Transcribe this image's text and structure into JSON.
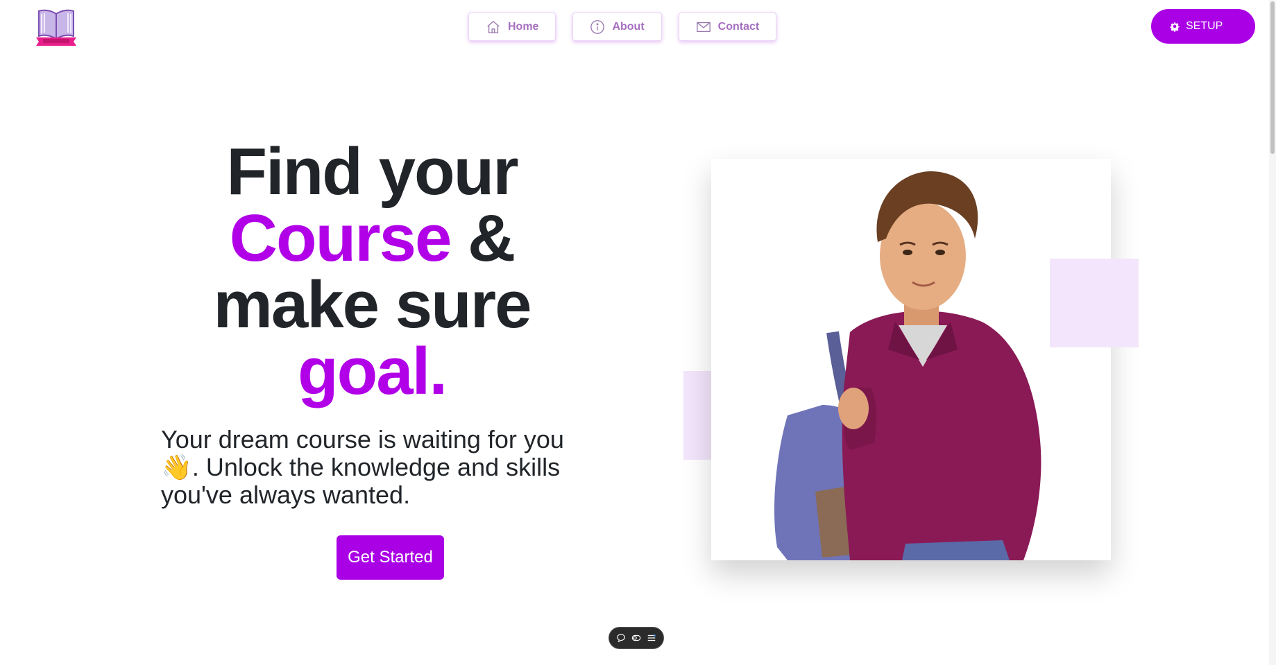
{
  "nav": {
    "home_label": "Home",
    "about_label": "About",
    "contact_label": "Contact",
    "setup_label": "SETUP"
  },
  "hero": {
    "title_line1": "Find your",
    "title_word_course": "Course",
    "title_amp": " &",
    "title_line3": "make sure",
    "title_word_goal": "goal.",
    "description_part1": "Your dream course is waiting for you ",
    "description_emoji": "👋",
    "description_part2": ". Unlock the knowledge and skills you've always wanted.",
    "cta_label": "Get Started"
  },
  "colors": {
    "accent": "#aa00e6",
    "accent_text": "#b100e8",
    "nav_text": "#a56fc0",
    "deco": "#f3e5fb"
  },
  "icons": [
    "book-logo-icon",
    "home-icon",
    "info-icon",
    "mail-icon",
    "gear-icon",
    "chat-icon",
    "toggle-icon",
    "menu-icon"
  ]
}
